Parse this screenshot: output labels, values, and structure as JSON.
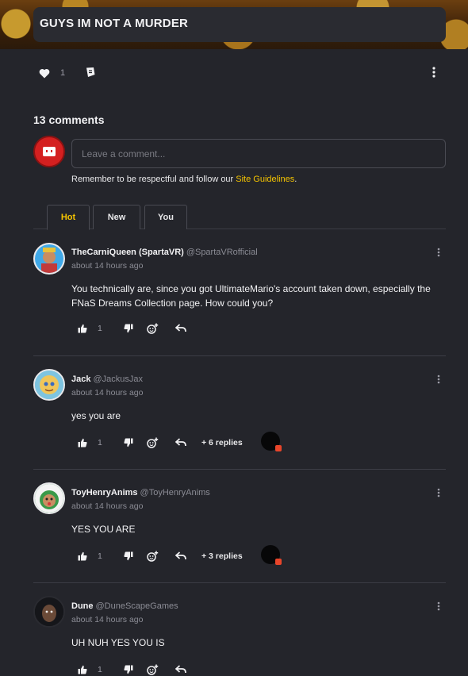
{
  "post": {
    "title": "GUYS IM NOT A MURDER",
    "likes": "1"
  },
  "comments_section": {
    "count_label": "13 comments",
    "input_placeholder": "Leave a comment...",
    "guidelines_prefix": "Remember to be respectful and follow our ",
    "guidelines_link": "Site Guidelines",
    "guidelines_suffix": ".",
    "tabs": [
      {
        "label": "Hot",
        "active": true
      },
      {
        "label": "New",
        "active": false
      },
      {
        "label": "You",
        "active": false
      }
    ]
  },
  "comments": [
    {
      "name": "TheCarniQueen (SpartaVR)",
      "handle": "@SpartaVRofficial",
      "time": "about 14 hours ago",
      "text": "You technically are, since you got UltimateMario's account taken down, especially the FNaS Dreams Collection page. How could you?",
      "likes": "1",
      "replies": ""
    },
    {
      "name": "Jack",
      "handle": "@JackusJax",
      "time": "about 14 hours ago",
      "text": "yes you are",
      "likes": "1",
      "replies": "+ 6 replies"
    },
    {
      "name": "ToyHenryAnims",
      "handle": "@ToyHenryAnims",
      "time": "about 14 hours ago",
      "text": "YES YOU ARE",
      "likes": "1",
      "replies": "+ 3 replies"
    },
    {
      "name": "Dune",
      "handle": "@DuneScapeGames",
      "time": "about 14 hours ago",
      "text": "UH NUH YES YOU IS",
      "likes": "1",
      "replies": ""
    }
  ],
  "colors": {
    "accent": "#f5c400",
    "background": "#24252b",
    "reply_indicator": "#e8452a"
  },
  "icons": [
    "heart-icon",
    "share-icon",
    "kebab-icon",
    "thumbs-up-icon",
    "thumbs-down-icon",
    "add-reaction-icon",
    "reply-icon"
  ]
}
